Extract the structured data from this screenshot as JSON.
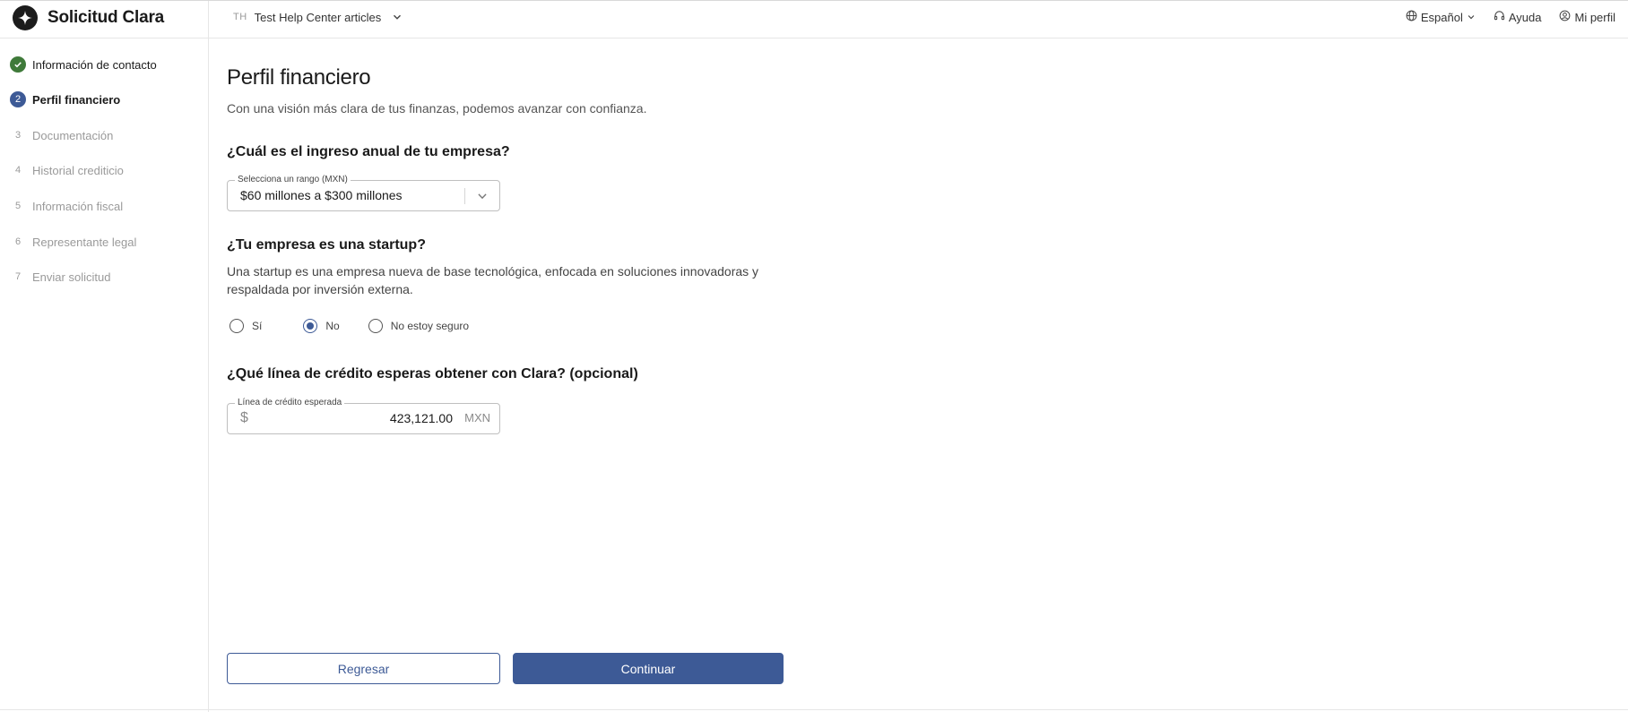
{
  "header": {
    "app_title": "Solicitud Clara",
    "org_initials": "TH",
    "org_name": "Test Help Center articles",
    "language_label": "Español",
    "help_label": "Ayuda",
    "profile_label": "Mi perfil"
  },
  "sidebar": {
    "steps": [
      {
        "marker": "",
        "label": "Información de contacto",
        "state": "done"
      },
      {
        "marker": "2",
        "label": "Perfil financiero",
        "state": "active"
      },
      {
        "marker": "3",
        "label": "Documentación",
        "state": "pending"
      },
      {
        "marker": "4",
        "label": "Historial crediticio",
        "state": "pending"
      },
      {
        "marker": "5",
        "label": "Información fiscal",
        "state": "pending"
      },
      {
        "marker": "6",
        "label": "Representante legal",
        "state": "pending"
      },
      {
        "marker": "7",
        "label": "Enviar solicitud",
        "state": "pending"
      }
    ]
  },
  "main": {
    "title": "Perfil financiero",
    "subtitle": "Con una visión más clara de tus finanzas, podemos avanzar con confianza.",
    "income": {
      "question": "¿Cuál es el ingreso anual de tu empresa?",
      "legend": "Selecciona un rango (MXN)",
      "selected": "$60 millones a $300 millones"
    },
    "startup": {
      "question": "¿Tu empresa es una startup?",
      "description": "Una startup es una empresa nueva de base tecnológica, enfocada en soluciones innovadoras y respaldada por inversión externa.",
      "options": [
        "Sí",
        "No",
        "No estoy seguro"
      ],
      "selected": "No"
    },
    "credit": {
      "question": "¿Qué línea de crédito esperas obtener con Clara? (opcional)",
      "legend": "Línea de crédito esperada",
      "prefix": "$",
      "value": "423,121.00",
      "suffix": "MXN"
    },
    "buttons": {
      "back": "Regresar",
      "continue": "Continuar"
    }
  },
  "colors": {
    "primary": "#3d5a96",
    "success": "#3f7a3a",
    "muted_text": "#9a9a9a",
    "border": "#e6e6e6"
  },
  "icons": {
    "brand": "clara-logo-icon",
    "language": "globe-icon",
    "help": "headset-icon",
    "profile": "user-circle-icon"
  }
}
